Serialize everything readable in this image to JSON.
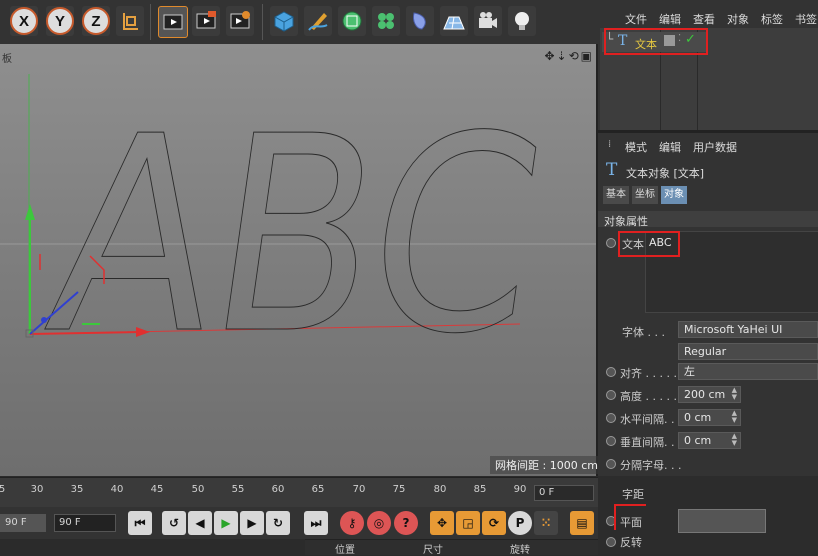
{
  "toolbar": {
    "axes": [
      "X",
      "Y",
      "Z"
    ],
    "icons": [
      "coordinate-system-icon",
      "render-view-icon",
      "render-queue-icon",
      "render-settings-icon",
      "cube-icon",
      "pen-icon",
      "subdivision-icon",
      "array-icon",
      "deformer-icon",
      "floor-icon",
      "camera-icon",
      "light-icon"
    ]
  },
  "viewport": {
    "label": "板",
    "nav_icons": "✥⇣⟲▣",
    "grid_spacing": "网格间距 : 1000 cm",
    "text_shown": "ABC"
  },
  "timeline": {
    "ticks": [
      "5",
      "30",
      "35",
      "40",
      "45",
      "50",
      "55",
      "60",
      "65",
      "70",
      "75",
      "80",
      "85",
      "90"
    ],
    "end_frame": "0 F",
    "start_field": "90 F",
    "end_field": "90 F"
  },
  "coord_bar": {
    "position": "位置",
    "size": "尺寸",
    "rotation": "旋转"
  },
  "object_manager": {
    "menu": [
      "文件",
      "编辑",
      "查看",
      "对象",
      "标签",
      "书签"
    ],
    "object_name": "文本"
  },
  "attributes": {
    "menu": [
      "模式",
      "编辑",
      "用户数据"
    ],
    "header": "文本对象 [文本]",
    "tabs": [
      "基本",
      "坐标",
      "对象"
    ],
    "section": "对象属性",
    "text_label": "文本",
    "text_value": "ABC",
    "font_label": "字体 . . .",
    "font_value": "Microsoft YaHei UI",
    "style_value": "Regular",
    "align_label": "对齐 . . . . .",
    "align_value": "左",
    "height_label": "高度 . . . . .",
    "height_value": "200 cm",
    "hspacing_label": "水平间隔. . .",
    "hspacing_value": "0 cm",
    "vspacing_label": "垂直间隔. . .",
    "vspacing_value": "0 cm",
    "separate_label": "分隔字母. . .",
    "kerning_label": "字距",
    "plane_label": "平面",
    "reverse_label": "反转"
  },
  "colors": {
    "highlight": "#e02020",
    "accent": "#6b8fb3",
    "x_axis": "#e03030",
    "y_axis": "#30c030"
  }
}
